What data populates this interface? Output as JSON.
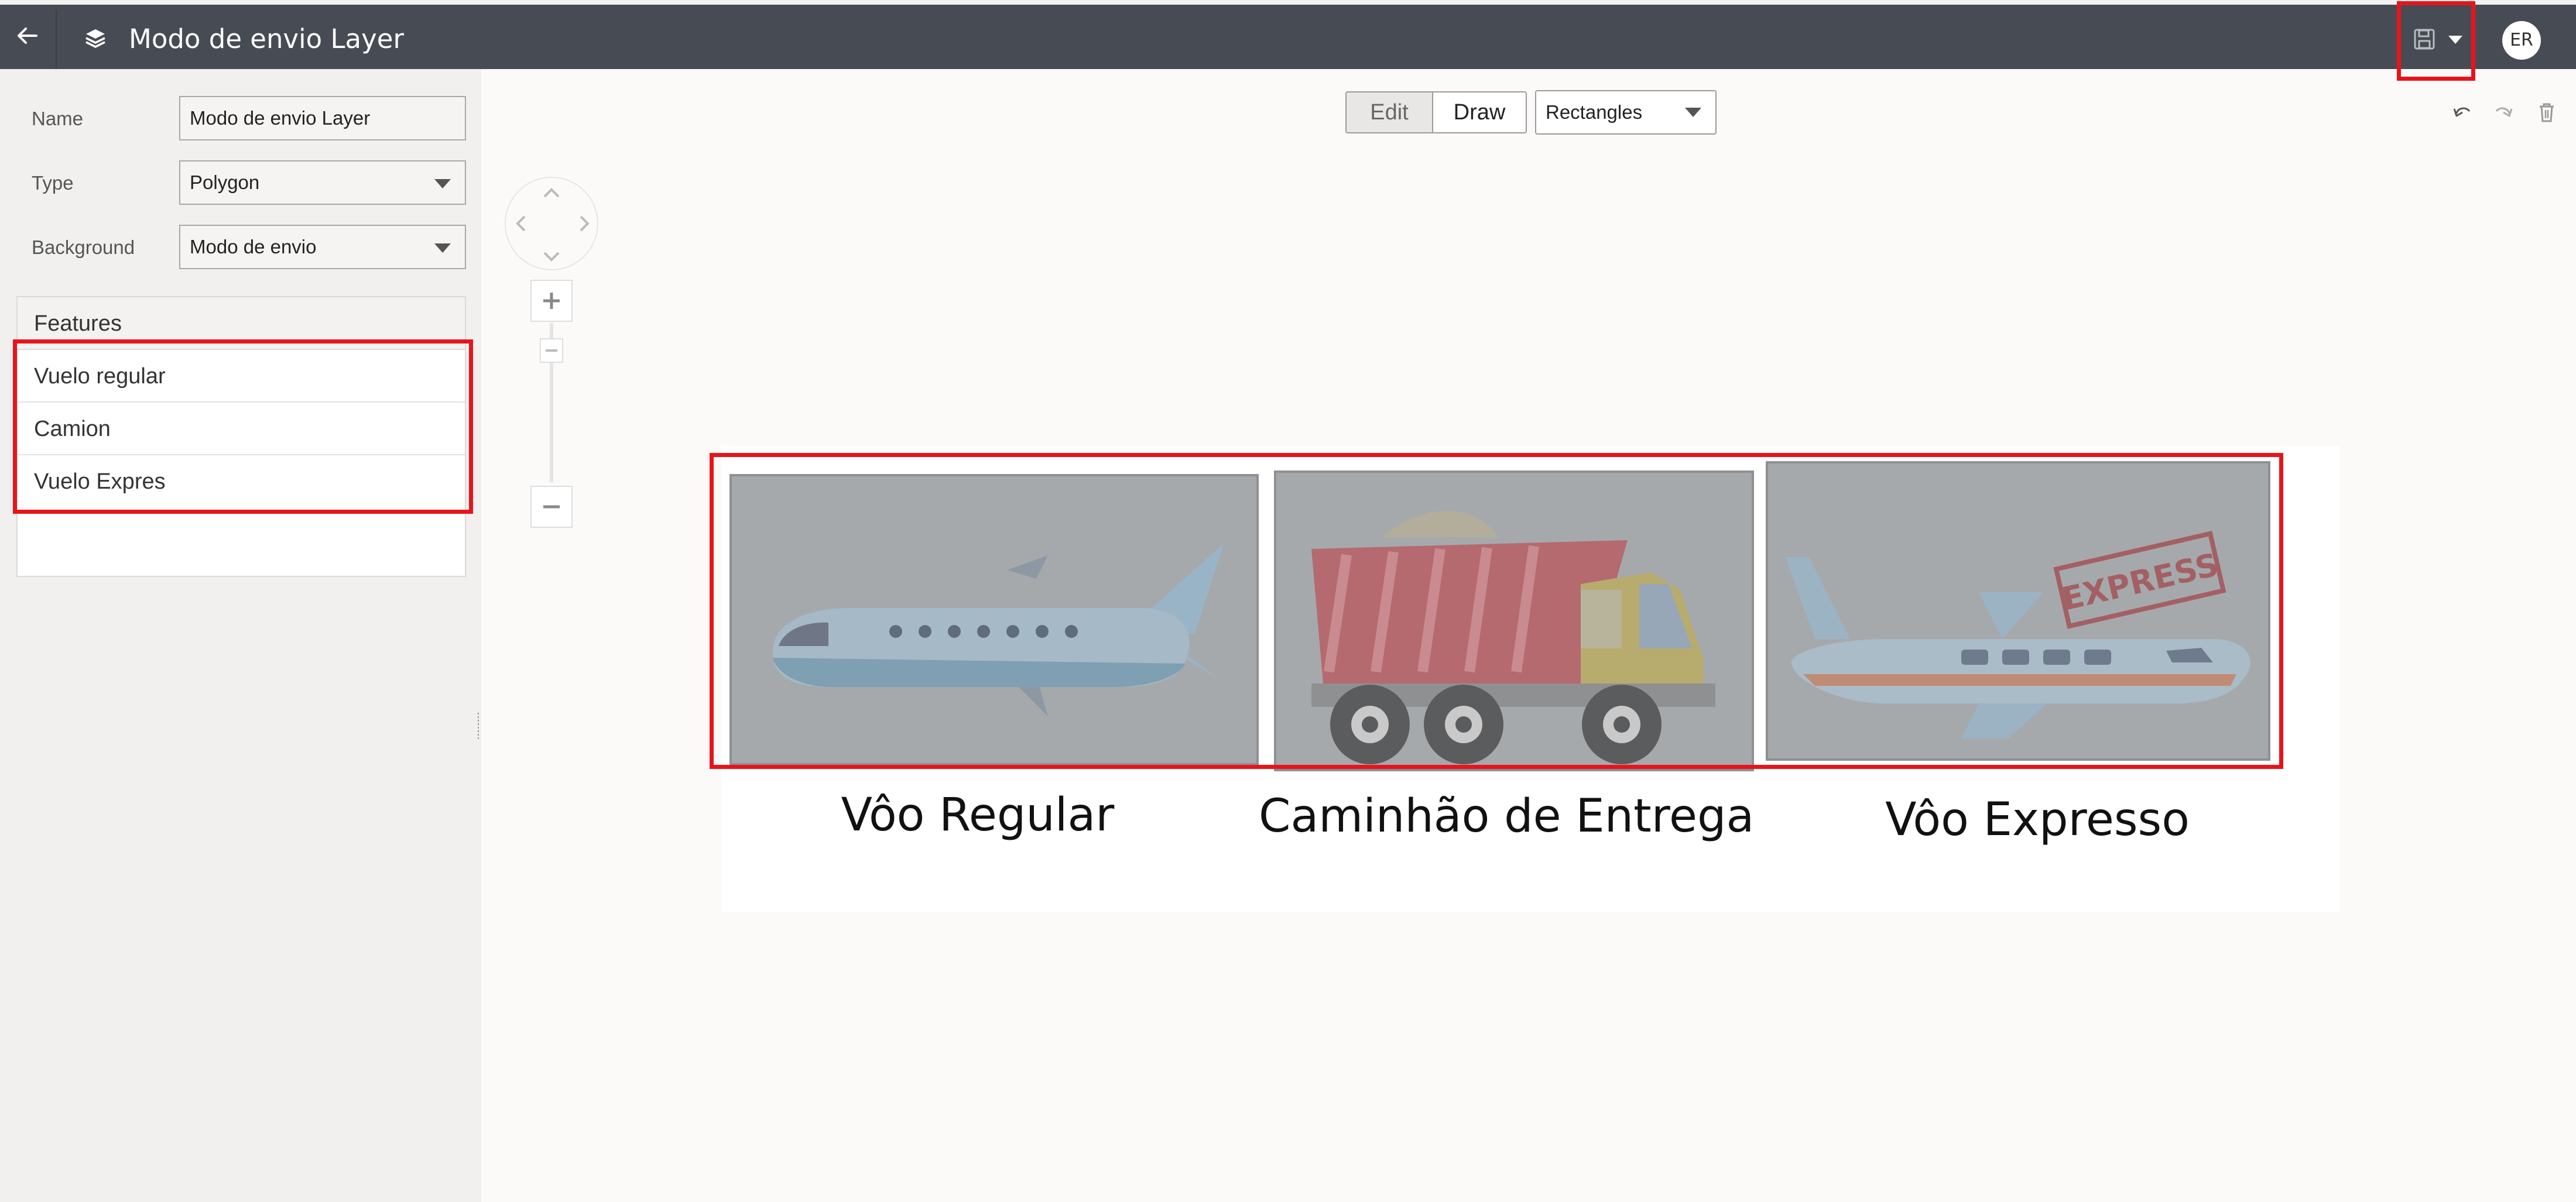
{
  "header": {
    "title": "Modo de envio Layer",
    "user_initials": "ER"
  },
  "form": {
    "name_label": "Name",
    "name_value": "Modo de envio Layer",
    "type_label": "Type",
    "type_value": "Polygon",
    "background_label": "Background",
    "background_value": "Modo de envio"
  },
  "features": {
    "header": "Features",
    "items": [
      "Vuelo regular",
      "Camion",
      "Vuelo Expres"
    ]
  },
  "toolbar": {
    "edit_label": "Edit",
    "draw_label": "Draw",
    "shape_value": "Rectangles"
  },
  "canvas": {
    "captions": [
      "Vôo Regular",
      "Caminhão de Entrega",
      "Vôo Expresso"
    ],
    "stamp_text": "EXPRESS"
  },
  "colors": {
    "header_bg": "#474c54",
    "highlight": "#e8141b",
    "tile_overlay": "#a6a9ac"
  }
}
